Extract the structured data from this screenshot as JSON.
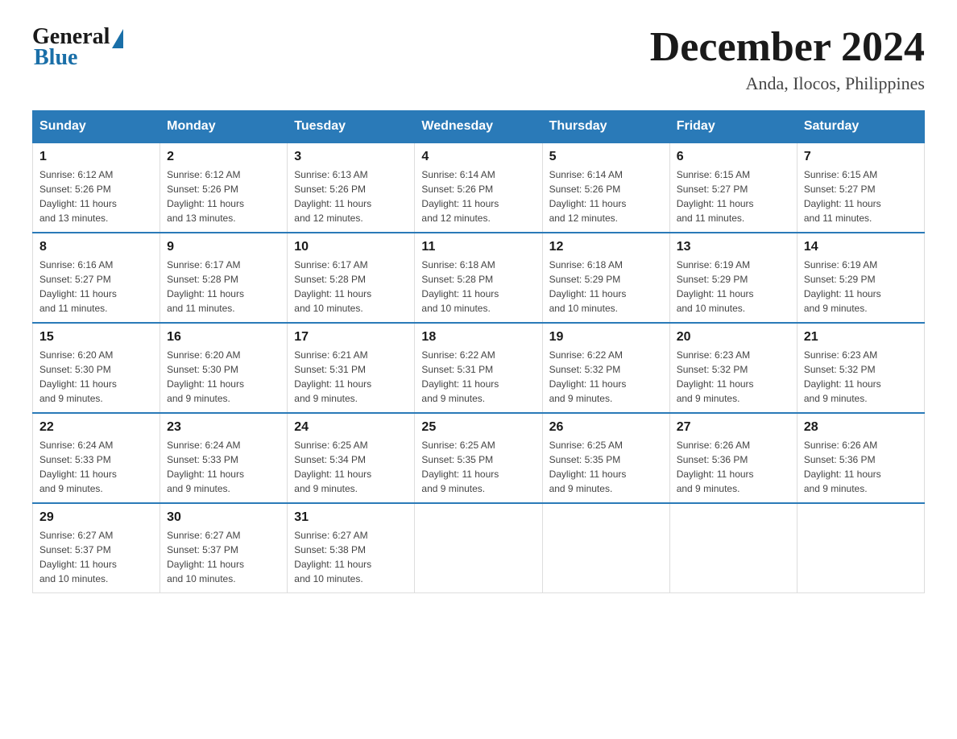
{
  "header": {
    "logo_general": "General",
    "logo_blue": "Blue",
    "month_title": "December 2024",
    "location": "Anda, Ilocos, Philippines"
  },
  "days_of_week": [
    "Sunday",
    "Monday",
    "Tuesday",
    "Wednesday",
    "Thursday",
    "Friday",
    "Saturday"
  ],
  "weeks": [
    [
      {
        "day": "1",
        "sunrise": "6:12 AM",
        "sunset": "5:26 PM",
        "daylight": "11 hours and 13 minutes."
      },
      {
        "day": "2",
        "sunrise": "6:12 AM",
        "sunset": "5:26 PM",
        "daylight": "11 hours and 13 minutes."
      },
      {
        "day": "3",
        "sunrise": "6:13 AM",
        "sunset": "5:26 PM",
        "daylight": "11 hours and 12 minutes."
      },
      {
        "day": "4",
        "sunrise": "6:14 AM",
        "sunset": "5:26 PM",
        "daylight": "11 hours and 12 minutes."
      },
      {
        "day": "5",
        "sunrise": "6:14 AM",
        "sunset": "5:26 PM",
        "daylight": "11 hours and 12 minutes."
      },
      {
        "day": "6",
        "sunrise": "6:15 AM",
        "sunset": "5:27 PM",
        "daylight": "11 hours and 11 minutes."
      },
      {
        "day": "7",
        "sunrise": "6:15 AM",
        "sunset": "5:27 PM",
        "daylight": "11 hours and 11 minutes."
      }
    ],
    [
      {
        "day": "8",
        "sunrise": "6:16 AM",
        "sunset": "5:27 PM",
        "daylight": "11 hours and 11 minutes."
      },
      {
        "day": "9",
        "sunrise": "6:17 AM",
        "sunset": "5:28 PM",
        "daylight": "11 hours and 11 minutes."
      },
      {
        "day": "10",
        "sunrise": "6:17 AM",
        "sunset": "5:28 PM",
        "daylight": "11 hours and 10 minutes."
      },
      {
        "day": "11",
        "sunrise": "6:18 AM",
        "sunset": "5:28 PM",
        "daylight": "11 hours and 10 minutes."
      },
      {
        "day": "12",
        "sunrise": "6:18 AM",
        "sunset": "5:29 PM",
        "daylight": "11 hours and 10 minutes."
      },
      {
        "day": "13",
        "sunrise": "6:19 AM",
        "sunset": "5:29 PM",
        "daylight": "11 hours and 10 minutes."
      },
      {
        "day": "14",
        "sunrise": "6:19 AM",
        "sunset": "5:29 PM",
        "daylight": "11 hours and 9 minutes."
      }
    ],
    [
      {
        "day": "15",
        "sunrise": "6:20 AM",
        "sunset": "5:30 PM",
        "daylight": "11 hours and 9 minutes."
      },
      {
        "day": "16",
        "sunrise": "6:20 AM",
        "sunset": "5:30 PM",
        "daylight": "11 hours and 9 minutes."
      },
      {
        "day": "17",
        "sunrise": "6:21 AM",
        "sunset": "5:31 PM",
        "daylight": "11 hours and 9 minutes."
      },
      {
        "day": "18",
        "sunrise": "6:22 AM",
        "sunset": "5:31 PM",
        "daylight": "11 hours and 9 minutes."
      },
      {
        "day": "19",
        "sunrise": "6:22 AM",
        "sunset": "5:32 PM",
        "daylight": "11 hours and 9 minutes."
      },
      {
        "day": "20",
        "sunrise": "6:23 AM",
        "sunset": "5:32 PM",
        "daylight": "11 hours and 9 minutes."
      },
      {
        "day": "21",
        "sunrise": "6:23 AM",
        "sunset": "5:32 PM",
        "daylight": "11 hours and 9 minutes."
      }
    ],
    [
      {
        "day": "22",
        "sunrise": "6:24 AM",
        "sunset": "5:33 PM",
        "daylight": "11 hours and 9 minutes."
      },
      {
        "day": "23",
        "sunrise": "6:24 AM",
        "sunset": "5:33 PM",
        "daylight": "11 hours and 9 minutes."
      },
      {
        "day": "24",
        "sunrise": "6:25 AM",
        "sunset": "5:34 PM",
        "daylight": "11 hours and 9 minutes."
      },
      {
        "day": "25",
        "sunrise": "6:25 AM",
        "sunset": "5:35 PM",
        "daylight": "11 hours and 9 minutes."
      },
      {
        "day": "26",
        "sunrise": "6:25 AM",
        "sunset": "5:35 PM",
        "daylight": "11 hours and 9 minutes."
      },
      {
        "day": "27",
        "sunrise": "6:26 AM",
        "sunset": "5:36 PM",
        "daylight": "11 hours and 9 minutes."
      },
      {
        "day": "28",
        "sunrise": "6:26 AM",
        "sunset": "5:36 PM",
        "daylight": "11 hours and 9 minutes."
      }
    ],
    [
      {
        "day": "29",
        "sunrise": "6:27 AM",
        "sunset": "5:37 PM",
        "daylight": "11 hours and 10 minutes."
      },
      {
        "day": "30",
        "sunrise": "6:27 AM",
        "sunset": "5:37 PM",
        "daylight": "11 hours and 10 minutes."
      },
      {
        "day": "31",
        "sunrise": "6:27 AM",
        "sunset": "5:38 PM",
        "daylight": "11 hours and 10 minutes."
      },
      null,
      null,
      null,
      null
    ]
  ],
  "labels": {
    "sunrise": "Sunrise:",
    "sunset": "Sunset:",
    "daylight": "Daylight:"
  }
}
